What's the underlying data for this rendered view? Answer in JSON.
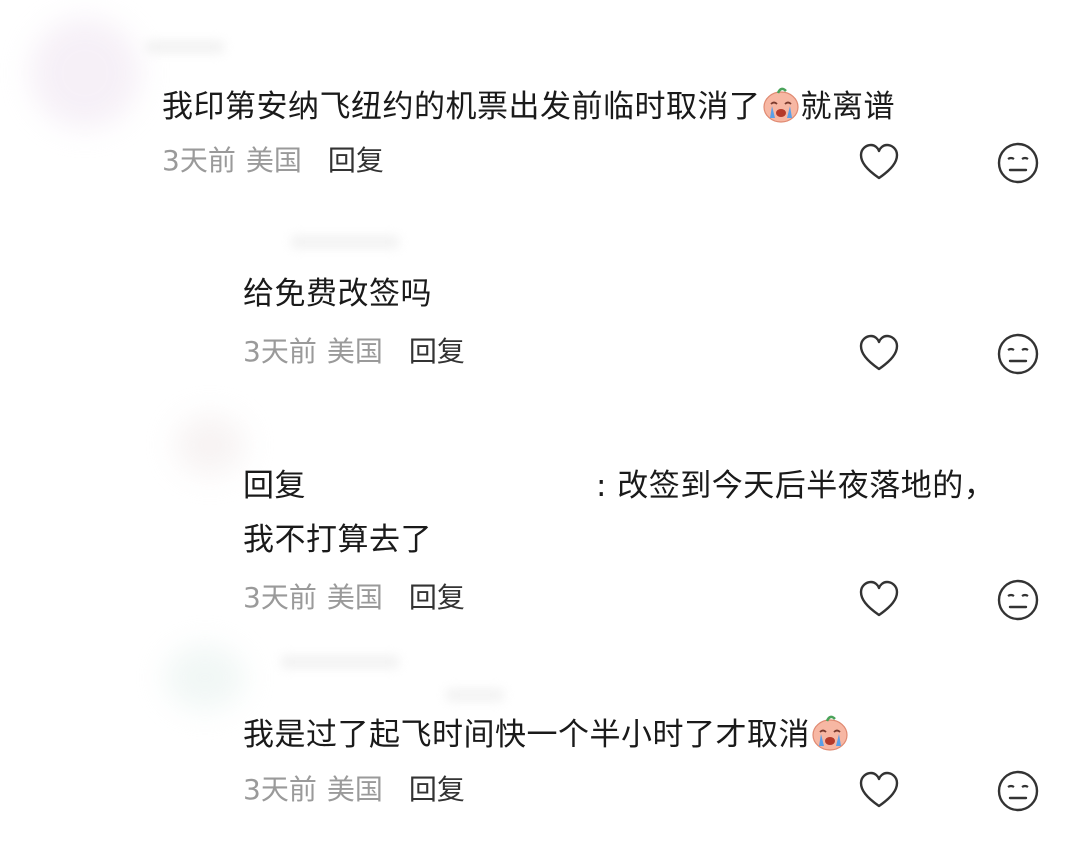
{
  "comments": [
    {
      "text_before": "我印第安纳飞纽约的机票出发前临时取消了",
      "emoji": "crying-face-emoji",
      "text_after": "就离谱",
      "time": "3天前",
      "region": "美国",
      "reply_label": "回复"
    },
    {
      "text": "给免费改签吗",
      "time": "3天前",
      "region": "美国",
      "reply_label": "回复"
    },
    {
      "reply_prefix": "回复",
      "text_line1": ": 改签到今天后半夜落地的，",
      "text_line2": "我不打算去了",
      "time": "3天前",
      "region": "美国",
      "reply_label": "回复"
    },
    {
      "text_before": "我是过了起飞时间快一个半小时了才取消",
      "emoji": "crying-face-emoji",
      "time": "3天前",
      "region": "美国",
      "reply_label": "回复"
    }
  ],
  "icons": {
    "like": "heart-outline-icon",
    "dislike": "neutral-face-icon"
  },
  "colors": {
    "text": "#1a1a1a",
    "meta": "#9a9a9a",
    "reply": "#333333",
    "icon_stroke": "#333333",
    "emoji_face": "#f7b7a3"
  }
}
